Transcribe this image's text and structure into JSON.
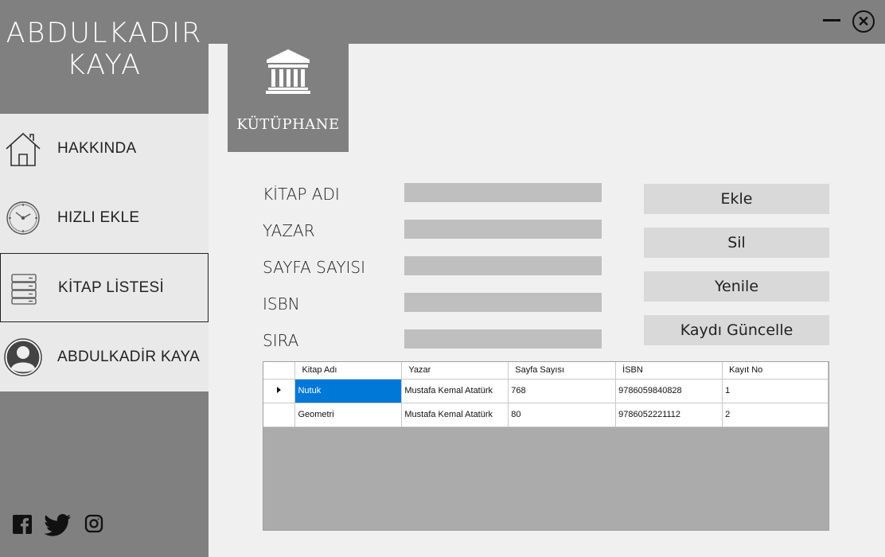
{
  "brand": {
    "line1": "ABDULKADIR",
    "line2": "KAYA"
  },
  "window": {
    "minimize_icon": "minimize-icon",
    "close_icon": "close-icon"
  },
  "sidebar": {
    "items": [
      {
        "label": "HAKKINDA",
        "icon": "home-icon"
      },
      {
        "label": "HIZLI EKLE",
        "icon": "clock-icon"
      },
      {
        "label": "KİTAP LİSTESİ",
        "icon": "server-icon",
        "active": true
      },
      {
        "label": "ABDULKADİR KAYA",
        "icon": "user-icon"
      }
    ],
    "social": [
      "facebook-icon",
      "twitter-icon",
      "instagram-icon"
    ]
  },
  "logo": {
    "text": "KÜTÜPHANE",
    "icon": "library-building-icon"
  },
  "form": {
    "fields": [
      {
        "label": "KİTAP ADI",
        "value": ""
      },
      {
        "label": "YAZAR",
        "value": ""
      },
      {
        "label": "SAYFA SAYISI",
        "value": ""
      },
      {
        "label": "ISBN",
        "value": ""
      },
      {
        "label": "SIRA",
        "value": ""
      }
    ]
  },
  "actions": {
    "add": "Ekle",
    "delete": "Sil",
    "refresh": "Yenile",
    "update": "Kaydı Güncelle"
  },
  "grid": {
    "columns": [
      "Kitap Adı",
      "Yazar",
      "Sayfa Sayısı",
      "İSBN",
      "Kayıt No"
    ],
    "rows": [
      {
        "cells": [
          "Nutuk",
          "Mustafa Kemal Atatürk",
          "768",
          "9786059840828",
          "1"
        ],
        "selected": true
      },
      {
        "cells": [
          "Geometri",
          "Mustafa Kemal Atatürk",
          "80",
          "9786052221112",
          "2"
        ],
        "selected": false
      }
    ]
  }
}
